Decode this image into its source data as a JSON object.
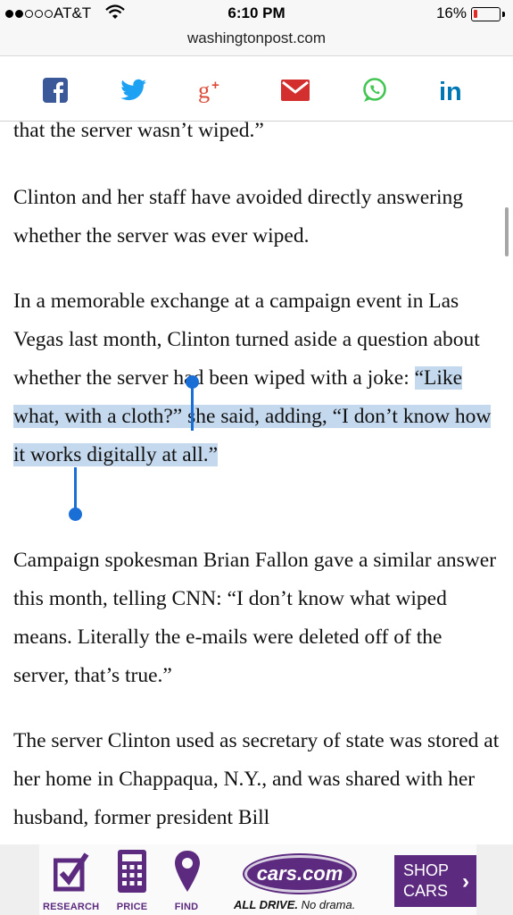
{
  "status_bar": {
    "carrier": "AT&T",
    "time": "6:10 PM",
    "battery_percent": "16%",
    "battery_level": 0.16,
    "signal_bars_filled": 2,
    "signal_bars_total": 5
  },
  "browser": {
    "url": "washingtonpost.com"
  },
  "share_bar": {
    "icons": [
      "facebook-icon",
      "twitter-icon",
      "google-plus-icon",
      "email-icon",
      "whatsapp-icon",
      "linkedin-icon"
    ],
    "colors": {
      "facebook": "#3b5998",
      "twitter": "#1da1f2",
      "google_plus": "#dd4b39",
      "email": "#d32f2f",
      "whatsapp": "#43c553",
      "linkedin": "#0077b5"
    }
  },
  "article": {
    "p0": "that the server wasn’t wiped.”",
    "p1": "Clinton and her staff have avoided directly answering whether the server was ever wiped.",
    "p2_before": "In a memorable exchange at a campaign event in Las Vegas last month, Clinton turned aside a question about whether the server had been wiped with a joke: ",
    "p2_selected": "“Like what, with a cloth?” she said, adding, “I don’t know how it works digitally at all.”",
    "p3": "Campaign spokesman Brian Fallon gave a similar answer this month, telling CNN: “I don’t know what wiped means. Literally the e-mails were deleted off of the server, that’s true.”",
    "p4": "The server Clinton used as secretary of state was stored at her home in Chappaqua, N.Y., and was shared with her husband, former president Bill",
    "selection_color": "#c5d9ee"
  },
  "ad": {
    "categories": [
      "RESEARCH",
      "PRICE",
      "FIND"
    ],
    "logo_text": "cars.com",
    "tagline_bold": "ALL DRIVE.",
    "tagline_rest": " No drama.",
    "cta_line1": "SHOP",
    "cta_line2": "CARS",
    "brand_color": "#5c2a7e"
  }
}
